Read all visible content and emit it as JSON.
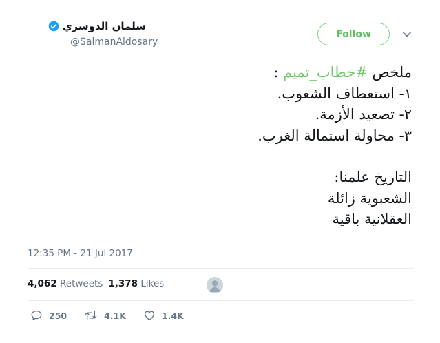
{
  "author": {
    "display_name": "سلمان الدوسري",
    "handle": "@SalmanAldosary",
    "verified": true
  },
  "follow_button": {
    "label": "Follow"
  },
  "tweet": {
    "line1_prefix": "ملخص ",
    "hashtag": "#خطاب_تميم",
    "line1_suffix": " :",
    "line2": "١- استعطاف الشعوب.",
    "line3": "٢- تصعيد الأزمة.",
    "line4": "٣- محاولة استمالة الغرب.",
    "line5": "التاريخ علمنا:",
    "line6": "الشعبوية زائلة",
    "line7": "العقلانية باقية"
  },
  "timestamp": "12:35 PM - 21 Jul 2017",
  "stats": {
    "retweets_count": "4,062",
    "retweets_label": "Retweets",
    "likes_count": "1,378",
    "likes_label": "Likes"
  },
  "actions": {
    "replies": "250",
    "retweets": "4.1K",
    "likes": "1.4K"
  },
  "colors": {
    "accent_green": "#5ec062",
    "verified_blue": "#1da1f2",
    "muted": "#657786"
  }
}
